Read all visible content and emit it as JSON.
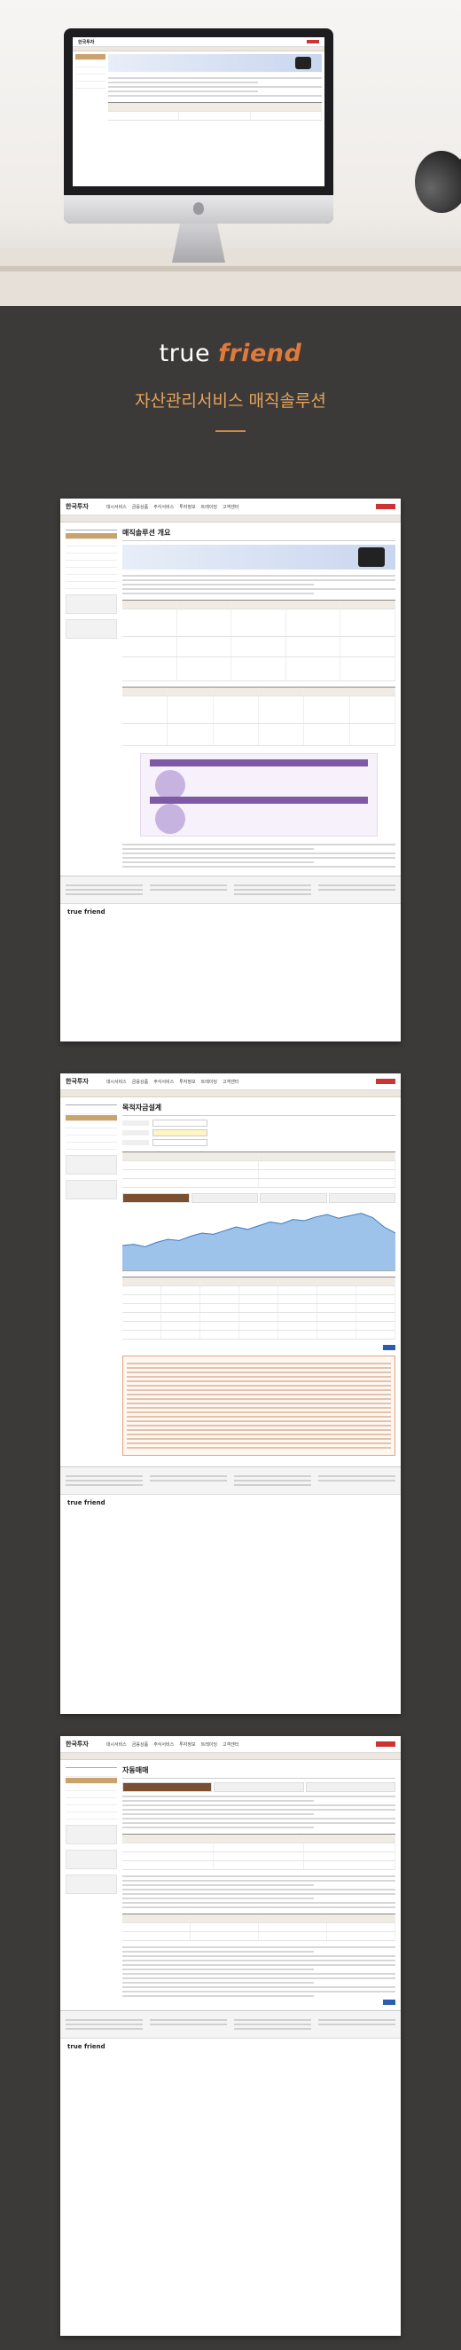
{
  "brand": {
    "prefix": "true",
    "friend": "friend"
  },
  "subtitle": "자산관리서비스 매직솔루션",
  "pages": [
    {
      "logo": "한국투자",
      "title": "매직솔루션 개요",
      "nav": [
        "대시서비스",
        "금융상품",
        "주식서비스",
        "투자정보",
        "트레이딩",
        "고객센터"
      ]
    },
    {
      "logo": "한국투자",
      "title": "목적자금설계",
      "nav": [
        "대시서비스",
        "금융상품",
        "주식서비스",
        "투자정보",
        "트레이딩",
        "고객센터"
      ]
    },
    {
      "logo": "한국투자",
      "title": "자동매매",
      "nav": [
        "대시서비스",
        "금융상품",
        "주식서비스",
        "투자정보",
        "트레이딩",
        "고객센터"
      ]
    }
  ],
  "chart_data": {
    "type": "area",
    "values": [
      40,
      42,
      38,
      45,
      50,
      48,
      55,
      60,
      58,
      64,
      70,
      66,
      72,
      78,
      75,
      82,
      80,
      86,
      90,
      84,
      88,
      92,
      85,
      70,
      60
    ]
  },
  "colors": {
    "accent": "#e07a3a",
    "gold": "#e6a35a",
    "bg": "#3b3a39"
  }
}
